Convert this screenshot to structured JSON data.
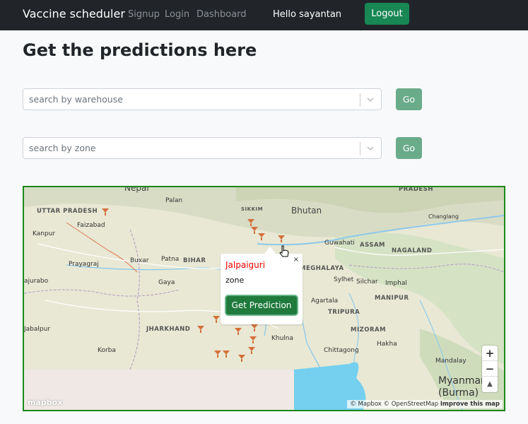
{
  "nav": {
    "brand": "Vaccine scheduler",
    "links": [
      "Signup",
      "Login",
      "Dashboard"
    ],
    "greeting": "Hello sayantan",
    "logout_label": "Logout"
  },
  "page_title": "Get the predictions here",
  "warehouse_search": {
    "placeholder": "search by warehouse",
    "go_label": "Go"
  },
  "zone_search": {
    "placeholder": "search by zone",
    "go_label": "Go"
  },
  "map": {
    "regions": [
      "UTTAR PRADESH",
      "BIHAR",
      "JHARKHAND",
      "ASSAM",
      "NAGALAND",
      "MEGHALAYA",
      "TRIPURA",
      "MIZORAM",
      "MANIPUR",
      "SIKKIM",
      "PRADESH"
    ],
    "countries": [
      "Nepal",
      "Bhutan",
      "Myanmar (Burma)"
    ],
    "cities": [
      "Kanpur",
      "Faizabad",
      "Prayagraj",
      "Buxar",
      "Patna",
      "Gaya",
      "Palan",
      "Jabalpur",
      "Korba",
      "Guwahati",
      "Sylhet",
      "Silchar",
      "Imphal",
      "Agartala",
      "Khulna",
      "Chittagong",
      "Hakha",
      "Mandalay",
      "Changlang",
      "ajurabo"
    ],
    "popup": {
      "title": "Jalpaiguri",
      "subtitle": "zone",
      "close": "×",
      "button_label": "Get Prediction"
    },
    "zoom_in": "+",
    "zoom_out": "−",
    "compass": "▲",
    "attribution": [
      "© Mapbox",
      "© OpenStreetMap",
      "Improve this map"
    ],
    "logo": "mapbox"
  }
}
